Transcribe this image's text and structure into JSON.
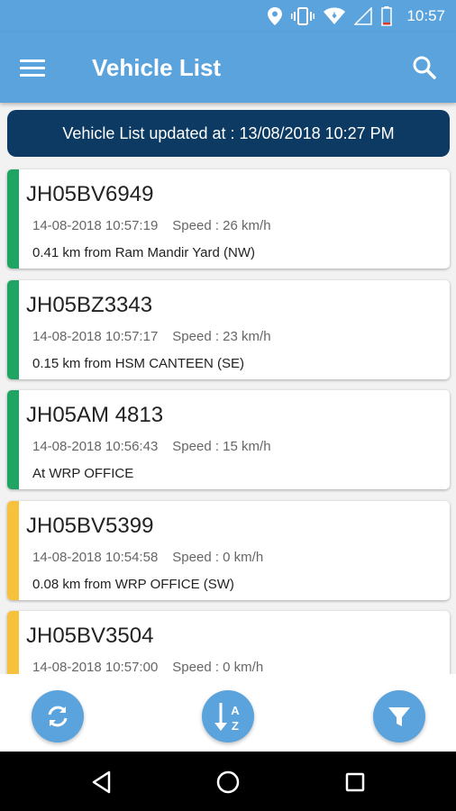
{
  "status_bar": {
    "time": "10:57",
    "icons": [
      "location-icon",
      "vibrate-icon",
      "wifi-icon",
      "signal-icon",
      "battery-icon"
    ]
  },
  "app_bar": {
    "title": "Vehicle List",
    "menu_icon": "hamburger-menu-icon",
    "search_icon": "search-icon"
  },
  "banner": {
    "text": "Vehicle List updated at : 13/08/2018 10:27 PM"
  },
  "colors": {
    "primary": "#5ba3dc",
    "banner": "#0d3a63",
    "moving": "#1fa464",
    "stopped": "#f6c23e"
  },
  "vehicles": [
    {
      "reg": "JH05BV6949",
      "datetime": "14-08-2018 10:57:19",
      "speed": "Speed : 26 km/h",
      "location": "0.41 km from Ram Mandir Yard (NW)",
      "status_color": "#1fa464"
    },
    {
      "reg": "JH05BZ3343",
      "datetime": "14-08-2018 10:57:17",
      "speed": "Speed : 23 km/h",
      "location": "0.15 km from HSM CANTEEN (SE)",
      "status_color": "#1fa464"
    },
    {
      "reg": "JH05AM 4813",
      "datetime": "14-08-2018 10:56:43",
      "speed": "Speed : 15 km/h",
      "location": "At WRP OFFICE",
      "status_color": "#1fa464"
    },
    {
      "reg": "JH05BV5399",
      "datetime": "14-08-2018 10:54:58",
      "speed": "Speed : 0 km/h",
      "location": "0.08 km from WRP OFFICE (SW)",
      "status_color": "#f6c23e"
    },
    {
      "reg": "JH05BV3504",
      "datetime": "14-08-2018 10:57:00",
      "speed": "Speed : 0 km/h",
      "location": "",
      "status_color": "#f6c23e"
    }
  ],
  "actions": {
    "refresh_icon": "refresh-icon",
    "sort_icon": "sort-az-icon",
    "filter_icon": "filter-icon"
  },
  "nav": {
    "back_icon": "back-icon",
    "home_icon": "home-icon",
    "recents_icon": "recents-icon"
  }
}
